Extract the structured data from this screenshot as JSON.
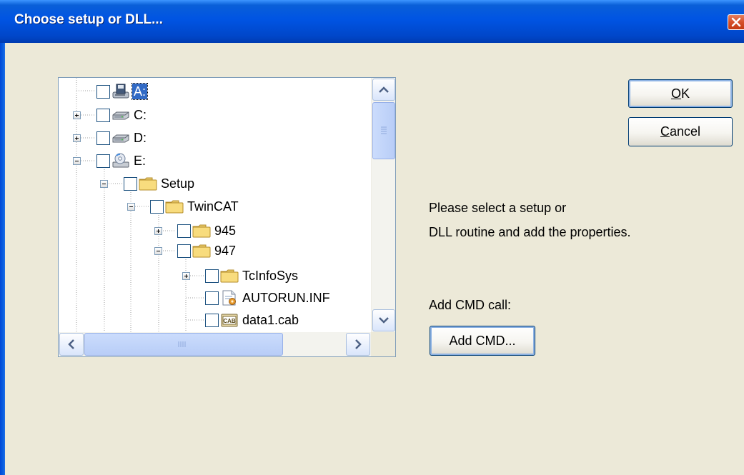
{
  "window": {
    "title": "Choose setup or DLL..."
  },
  "tree": {
    "items": [
      {
        "label": "A:",
        "icon": "floppy-drive-icon",
        "expander": "none",
        "selected": true
      },
      {
        "label": "C:",
        "icon": "hard-drive-icon",
        "expander": "plus"
      },
      {
        "label": "D:",
        "icon": "hard-drive-icon",
        "expander": "plus"
      },
      {
        "label": "E:",
        "icon": "cd-drive-icon",
        "expander": "minus"
      },
      {
        "label": "Setup",
        "icon": "folder-icon",
        "expander": "minus"
      },
      {
        "label": "TwinCAT",
        "icon": "folder-icon",
        "expander": "minus"
      },
      {
        "label": "945",
        "icon": "folder-icon",
        "expander": "plus"
      },
      {
        "label": "947",
        "icon": "folder-icon",
        "expander": "minus"
      },
      {
        "label": "TcInfoSys",
        "icon": "folder-icon",
        "expander": "plus"
      },
      {
        "label": "AUTORUN.INF",
        "icon": "inf-file-icon",
        "expander": "none"
      },
      {
        "label": "data1.cab",
        "icon": "cab-file-icon",
        "expander": "none"
      }
    ],
    "cab_icon_text": "CAB"
  },
  "buttons": {
    "ok": {
      "mnemonic": "O",
      "rest": "K"
    },
    "cancel": {
      "mnemonic": "C",
      "rest": "ancel"
    },
    "add_cmd": "Add CMD..."
  },
  "info": {
    "line1": "Please select a setup or",
    "line2": "DLL routine and add the properties."
  },
  "cmd": {
    "label": "Add CMD call:"
  },
  "colors": {
    "titlebar": "#0054e3",
    "dialog_bg": "#ece9d8",
    "selection": "#316ac5",
    "button_border": "#003c74"
  }
}
